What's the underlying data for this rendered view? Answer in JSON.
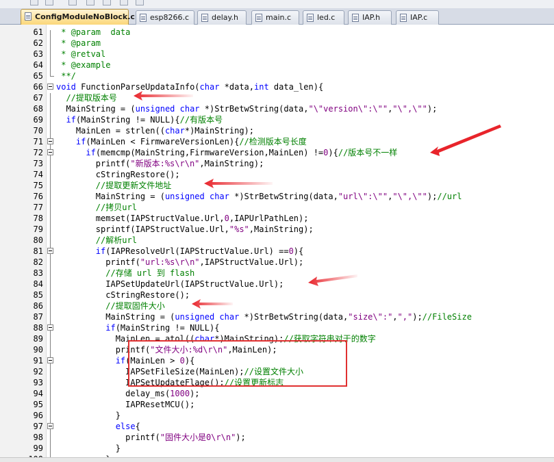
{
  "tabs": [
    {
      "label": "ConfigModuleNoBlock.c",
      "active": true
    },
    {
      "label": "esp8266.c",
      "active": false
    },
    {
      "label": "delay.h",
      "active": false
    },
    {
      "label": "main.c",
      "active": false
    },
    {
      "label": "led.c",
      "active": false
    },
    {
      "label": "IAP.h",
      "active": false
    },
    {
      "label": "IAP.c",
      "active": false
    }
  ],
  "lines": [
    {
      "n": "61",
      "parts": [
        [
          "c",
          " * @param  data"
        ]
      ]
    },
    {
      "n": "62",
      "parts": [
        [
          "c",
          " * @param"
        ]
      ]
    },
    {
      "n": "63",
      "parts": [
        [
          "c",
          " * @retval"
        ]
      ]
    },
    {
      "n": "64",
      "parts": [
        [
          "c",
          " * @example"
        ]
      ]
    },
    {
      "n": "65",
      "parts": [
        [
          "c",
          " **/"
        ]
      ]
    },
    {
      "n": "66",
      "parts": [
        [
          "k",
          "void"
        ],
        [
          "",
          " FunctionParseUpdataInfo("
        ],
        [
          "k",
          "char"
        ],
        [
          "",
          " *data,"
        ],
        [
          "k",
          "int"
        ],
        [
          "",
          " data_len){"
        ]
      ]
    },
    {
      "n": "67",
      "parts": [
        [
          "c",
          "  //提取版本号"
        ]
      ]
    },
    {
      "n": "68",
      "parts": [
        [
          "",
          "  MainString = ("
        ],
        [
          "k",
          "unsigned char"
        ],
        [
          "",
          " *)StrBetwString(data,"
        ],
        [
          "s",
          "\"\\\"version\\\":\\\"\""
        ],
        [
          "",
          ","
        ],
        [
          "s",
          "\"\\\",\\\"\""
        ],
        [
          "",
          ");"
        ]
      ]
    },
    {
      "n": "69",
      "parts": [
        [
          "",
          "  "
        ],
        [
          "k",
          "if"
        ],
        [
          "",
          "(MainString != NULL){"
        ],
        [
          "c",
          "//有版本号"
        ]
      ]
    },
    {
      "n": "70",
      "parts": [
        [
          "",
          "    MainLen = strlen(("
        ],
        [
          "k",
          "char"
        ],
        [
          "",
          "*)MainString);"
        ]
      ]
    },
    {
      "n": "71",
      "parts": [
        [
          "",
          "    "
        ],
        [
          "k",
          "if"
        ],
        [
          "",
          "(MainLen < FirmwareVersionLen){"
        ],
        [
          "c",
          "//检测版本号长度"
        ]
      ]
    },
    {
      "n": "72",
      "parts": [
        [
          "",
          "      "
        ],
        [
          "k",
          "if"
        ],
        [
          "",
          "(memcmp(MainString,FirmwareVersion,MainLen) !="
        ],
        [
          "n",
          "0"
        ],
        [
          "",
          "){"
        ],
        [
          "c",
          "//版本号不一样"
        ]
      ]
    },
    {
      "n": "73",
      "parts": [
        [
          "",
          "        printf("
        ],
        [
          "s",
          "\"新版本:%s\\r\\n\""
        ],
        [
          "",
          ",MainString);"
        ]
      ]
    },
    {
      "n": "74",
      "parts": [
        [
          "",
          "        cStringRestore();"
        ]
      ]
    },
    {
      "n": "75",
      "parts": [
        [
          "c",
          "        //提取更新文件地址"
        ]
      ]
    },
    {
      "n": "76",
      "parts": [
        [
          "",
          "        MainString = ("
        ],
        [
          "k",
          "unsigned char"
        ],
        [
          "",
          " *)StrBetwString(data,"
        ],
        [
          "s",
          "\"url\\\":\\\"\""
        ],
        [
          "",
          ","
        ],
        [
          "s",
          "\"\\\",\\\"\""
        ],
        [
          "",
          ");"
        ],
        [
          "c",
          "//url"
        ]
      ]
    },
    {
      "n": "77",
      "parts": [
        [
          "c",
          "        //拷贝url"
        ]
      ]
    },
    {
      "n": "78",
      "parts": [
        [
          "",
          "        memset(IAPStructValue.Url,"
        ],
        [
          "n",
          "0"
        ],
        [
          "",
          ",IAPUrlPathLen);"
        ]
      ]
    },
    {
      "n": "79",
      "parts": [
        [
          "",
          "        sprintf(IAPStructValue.Url,"
        ],
        [
          "s",
          "\"%s\""
        ],
        [
          "",
          ",MainString);"
        ]
      ]
    },
    {
      "n": "80",
      "parts": [
        [
          "c",
          "        //解析url"
        ]
      ]
    },
    {
      "n": "81",
      "parts": [
        [
          "",
          "        "
        ],
        [
          "k",
          "if"
        ],
        [
          "",
          "(IAPResolveUrl(IAPStructValue.Url) =="
        ],
        [
          "n",
          "0"
        ],
        [
          "",
          "){"
        ]
      ]
    },
    {
      "n": "82",
      "parts": [
        [
          "",
          "          printf("
        ],
        [
          "s",
          "\"url:%s\\r\\n\""
        ],
        [
          "",
          ",IAPStructValue.Url);"
        ]
      ]
    },
    {
      "n": "83",
      "parts": [
        [
          "c",
          "          //存储 url 到 flash"
        ]
      ]
    },
    {
      "n": "84",
      "parts": [
        [
          "",
          "          IAPSetUpdateUrl(IAPStructValue.Url);"
        ]
      ]
    },
    {
      "n": "85",
      "parts": [
        [
          "",
          "          cStringRestore();"
        ]
      ]
    },
    {
      "n": "86",
      "parts": [
        [
          "c",
          "          //提取固件大小"
        ]
      ]
    },
    {
      "n": "87",
      "parts": [
        [
          "",
          "          MainString = ("
        ],
        [
          "k",
          "unsigned char"
        ],
        [
          "",
          " *)StrBetwString(data,"
        ],
        [
          "s",
          "\"size\\\":\""
        ],
        [
          "",
          ","
        ],
        [
          "s",
          "\",\""
        ],
        [
          "",
          ");"
        ],
        [
          "c",
          "//FileSize"
        ]
      ]
    },
    {
      "n": "88",
      "parts": [
        [
          "",
          "          "
        ],
        [
          "k",
          "if"
        ],
        [
          "",
          "(MainString != NULL){"
        ]
      ]
    },
    {
      "n": "89",
      "parts": [
        [
          "",
          "            MainLen = atol(("
        ],
        [
          "k",
          "char"
        ],
        [
          "",
          "*)MainString);"
        ],
        [
          "c",
          "//获取字符串对于的数字"
        ]
      ]
    },
    {
      "n": "90",
      "parts": [
        [
          "",
          "            printf("
        ],
        [
          "s",
          "\"文件大小:%d\\r\\n\""
        ],
        [
          "",
          ",MainLen);"
        ]
      ]
    },
    {
      "n": "91",
      "parts": [
        [
          "",
          "            "
        ],
        [
          "k",
          "if"
        ],
        [
          "",
          "(MainLen > "
        ],
        [
          "n",
          "0"
        ],
        [
          "",
          "){"
        ]
      ]
    },
    {
      "n": "92",
      "parts": [
        [
          "",
          "              IAPSetFileSize(MainLen);"
        ],
        [
          "c",
          "//设置文件大小"
        ]
      ]
    },
    {
      "n": "93",
      "parts": [
        [
          "",
          "              IAPSetUpdateFlage();"
        ],
        [
          "c",
          "//设置更新标志"
        ]
      ]
    },
    {
      "n": "94",
      "parts": [
        [
          "",
          "              delay_ms("
        ],
        [
          "n",
          "1000"
        ],
        [
          "",
          ");"
        ]
      ]
    },
    {
      "n": "95",
      "parts": [
        [
          "",
          "              IAPResetMCU();"
        ]
      ]
    },
    {
      "n": "96",
      "parts": [
        [
          "",
          "            }"
        ]
      ]
    },
    {
      "n": "97",
      "parts": [
        [
          "",
          "            "
        ],
        [
          "k",
          "else"
        ],
        [
          "",
          "{"
        ]
      ]
    },
    {
      "n": "98",
      "parts": [
        [
          "",
          "              printf("
        ],
        [
          "s",
          "\"固件大小是0\\r\\n\""
        ],
        [
          "",
          ");"
        ]
      ]
    },
    {
      "n": "99",
      "parts": [
        [
          "",
          "            }"
        ]
      ]
    },
    {
      "n": "100",
      "parts": [
        [
          "",
          "          }"
        ]
      ]
    }
  ]
}
